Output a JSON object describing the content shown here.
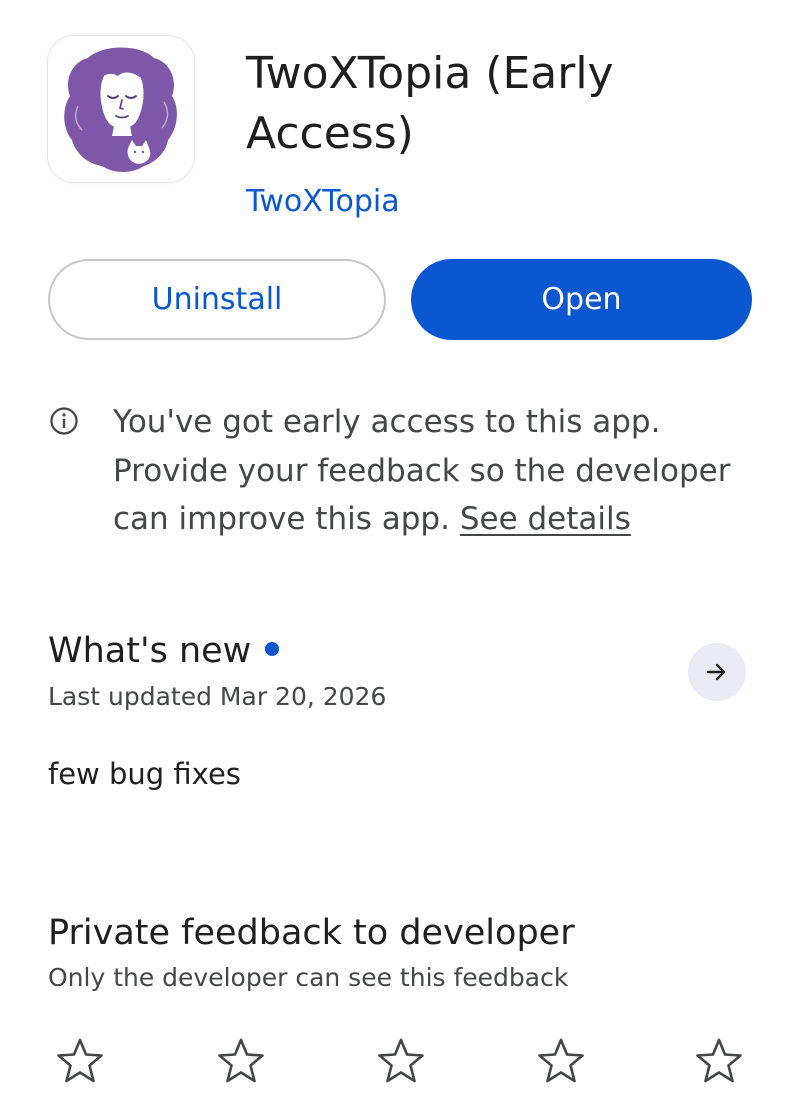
{
  "app": {
    "title": "TwoXTopia (Early Access)",
    "developer": "TwoXTopia",
    "icon": "app-icon-woman-with-cat"
  },
  "actions": {
    "uninstall_label": "Uninstall",
    "open_label": "Open"
  },
  "early_access": {
    "icon": "info-icon",
    "message": "You've got early access to this app. Provide your feedback so the developer can improve this app.",
    "link_label": "See details"
  },
  "whats_new": {
    "heading": "What's new",
    "last_updated": "Last updated Mar 20, 2026",
    "notes": "few bug fixes",
    "arrow_icon": "arrow-right-icon"
  },
  "feedback": {
    "heading": "Private feedback to developer",
    "subtitle": "Only the developer can see this feedback",
    "star_icon": "star-outline-icon",
    "rating": 0,
    "max_rating": 5
  },
  "colors": {
    "accent": "#0b57d0",
    "icon_purple": "#7e57a8",
    "text_primary": "#1f1f1f",
    "text_secondary": "#444746"
  }
}
